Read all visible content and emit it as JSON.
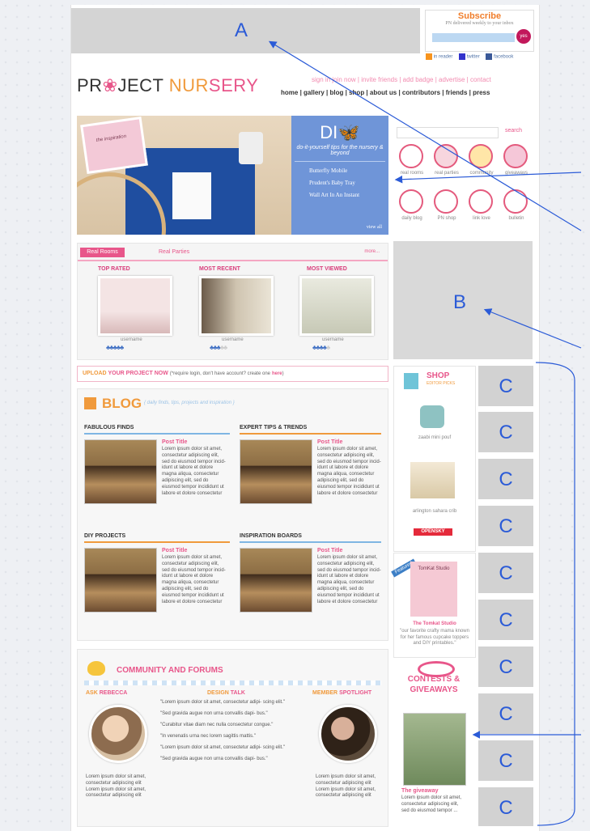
{
  "callouts": {
    "a": "A",
    "b": "B",
    "c": "C"
  },
  "subscribe": {
    "title": "Subscribe",
    "subtitle": "PN delivered weekly to your inbox",
    "button": "yes"
  },
  "social": [
    "in reader",
    "twitter",
    "facebook"
  ],
  "logo": {
    "left": "PR",
    "middle": "JECT",
    "right_a": "NUR",
    "right_b": "SERY"
  },
  "top_links": "sign in  join now  |  invite friends  |  add badge  |  advertise  |  contact",
  "nav": [
    "home",
    "gallery",
    "blog",
    "shop",
    "about us",
    "contributors",
    "friends",
    "press"
  ],
  "diy": {
    "title": "DI",
    "tag": "do-it-yourself tips for the nursery & beyond",
    "items": [
      "Butterfly Mobile",
      "Prudent's Baby Tray",
      "Wall Art In An Instant"
    ],
    "view_all": "view all",
    "photo_label": "the inspiration"
  },
  "search_button": "search",
  "sidebar_icons": [
    "real rooms",
    "real parties",
    "community",
    "giveaways",
    "daily blog",
    "PN shop",
    "link love",
    "bulletin"
  ],
  "rooms": {
    "tab1": "Real Rooms",
    "tab2": "Real Parties",
    "more": "more...",
    "cols": [
      {
        "head": "TOP RATED",
        "user": "username"
      },
      {
        "head": "MOST RECENT",
        "user": "username"
      },
      {
        "head": "MOST VIEWED",
        "user": "username"
      }
    ]
  },
  "upload": {
    "up": "UPLOAD",
    "rest": "YOUR PROJECT NOW",
    "note": "(*require login, don't have account? create one",
    "here": "here"
  },
  "blog": {
    "title": "BLOG",
    "tagline": "{ daily finds, tips, projects and inspiration }",
    "sections": [
      {
        "head": "FABULOUS FINDS",
        "post": "Post Title"
      },
      {
        "head": "EXPERT TIPS & TRENDS",
        "post": "Post Title"
      },
      {
        "head": "DIY PROJECTS",
        "post": "Post Title"
      },
      {
        "head": "INSPIRATION BOARDS",
        "post": "Post Title"
      }
    ],
    "lorem": "Lorem ipsum dolor sit amet, consectetur adipiscing elit, sed do eiusmod tempor incid- idunt ut labore et dolore magna aliqua, consectetur adipiscing elit, sed do eiusmod tempor incididunt ut labore et dolore consectetur"
  },
  "shop": {
    "title": "SHOP",
    "sub": "EDITOR PICKS",
    "item1": "zaabi mini pouf",
    "item2": "arlington sahara crib",
    "brand": "OPENSKY"
  },
  "featured": {
    "label": "Featured",
    "shop_name": "The Tomkat Studio",
    "desc": "\"our favorite crafty mama known for her famous cupcake toppers and DIY printables.\"",
    "sign": "TomKat Studio"
  },
  "contests": {
    "title": "CONTESTS & GIVEAWAYS",
    "post": "The giveaway",
    "desc": "Lorem ipsum dolor sit amet, consectetur adipiscing elit, sed do eiusmod tempor ..."
  },
  "community": {
    "title": "COMMUNITY AND FORUMS",
    "ask_a": "ASK",
    "ask_b": "REBECCA",
    "design_a": "DESIGN",
    "design_b": "TALK",
    "member_a": "MEMBER",
    "member_b": "SPOTLIGHT",
    "quotes": [
      "\"Lorem ipsum dolor sit amet, consectetur adipi- scing elit.\"",
      "\"Sed gravida augue non urna convallis dapi- bus.\"",
      "\"Curabitur vitae diam nec nulla consectetur congue.\"",
      "\"In venenatis urna nec lorem sagittis mattis.\"",
      "\"Lorem ipsum dolor sit amet, consectetur adipi- scing elit.\"",
      "\"Sed gravida augue non urna convallis dapi- bus.\""
    ],
    "lorem_short": "Lorem ipsum dolor sit amet, consectetur adipiscing elit Lorem ipsum dolor sit amet, consectetur adipiscing elit"
  }
}
